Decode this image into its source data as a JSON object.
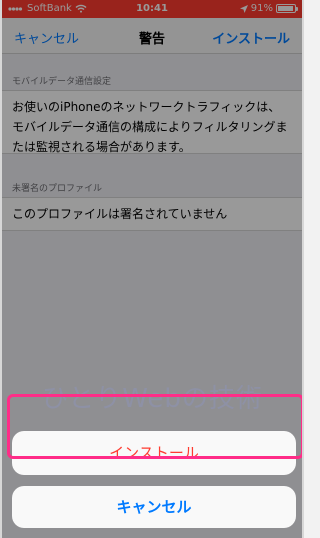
{
  "status_bar": {
    "carrier": "SoftBank",
    "time": "10:41",
    "battery_percent": "91%",
    "battery_level": 0.91,
    "icons": [
      "signal-icon",
      "wifi-icon",
      "location-icon",
      "battery-icon"
    ]
  },
  "nav": {
    "left": "キャンセル",
    "title": "警告",
    "right": "インストール"
  },
  "sections": [
    {
      "header": "モバイルデータ通信設定",
      "body": "お使いのiPhoneのネットワークトラフィックは、モバイルデータ通信の構成によりフィルタリングまたは監視される場合があります。"
    },
    {
      "header": "未署名のプロファイル",
      "body": "このプロファイルは署名されていません"
    }
  ],
  "watermark": "ひとりWebの技術",
  "action_sheet": {
    "install": "インストール",
    "cancel": "キャンセル"
  },
  "colors": {
    "status_bar": "#ff3b30",
    "link": "#007aff",
    "destructive": "#ff3b30",
    "highlight": "#ff2d88"
  }
}
